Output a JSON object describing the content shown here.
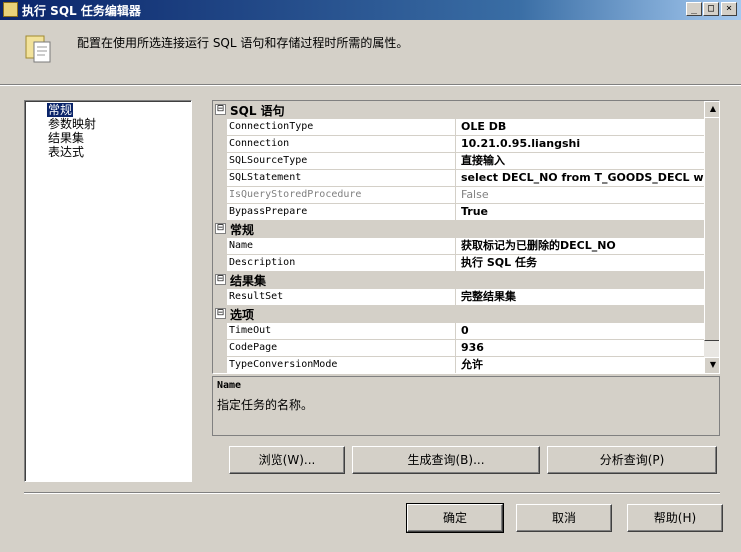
{
  "window": {
    "title": "执行 SQL 任务编辑器",
    "controls": {
      "minimize": "_",
      "maximize": "□",
      "close": "×"
    }
  },
  "header": {
    "description": "配置在使用所选连接运行 SQL 语句和存储过程时所需的属性。",
    "icon": "task-document-icon"
  },
  "nav": {
    "items": [
      {
        "label": "常规",
        "selected": true
      },
      {
        "label": "参数映射",
        "selected": false
      },
      {
        "label": "结果集",
        "selected": false
      },
      {
        "label": "表达式",
        "selected": false
      }
    ]
  },
  "grid": {
    "categories": [
      {
        "label": "SQL 语句",
        "expander": "⊟",
        "rows": [
          {
            "name": "ConnectionType",
            "value": "OLE DB"
          },
          {
            "name": "Connection",
            "value": "10.21.0.95.liangshi"
          },
          {
            "name": "SQLSourceType",
            "value": "直接输入"
          },
          {
            "name": "SQLStatement",
            "value": "select DECL_NO from T_GOODS_DECL wh"
          },
          {
            "name": "IsQueryStoredProcedure",
            "value": "False",
            "disabled": true
          },
          {
            "name": "BypassPrepare",
            "value": "True"
          }
        ]
      },
      {
        "label": "常规",
        "expander": "⊟",
        "rows": [
          {
            "name": "Name",
            "value": "获取标记为已删除的DECL_NO"
          },
          {
            "name": "Description",
            "value": "执行 SQL 任务"
          }
        ]
      },
      {
        "label": "结果集",
        "expander": "⊟",
        "rows": [
          {
            "name": "ResultSet",
            "value": "完整结果集"
          }
        ]
      },
      {
        "label": "选项",
        "expander": "⊟",
        "rows": [
          {
            "name": "TimeOut",
            "value": "0"
          },
          {
            "name": "CodePage",
            "value": "936"
          },
          {
            "name": "TypeConversionMode",
            "value": "允许"
          }
        ]
      }
    ]
  },
  "description_panel": {
    "title": "Name",
    "text": "指定任务的名称。"
  },
  "actions": {
    "browse": "浏览(W)...",
    "build_query": "生成查询(B)...",
    "parse_query": "分析查询(P)"
  },
  "footer": {
    "ok": "确定",
    "cancel": "取消",
    "help": "帮助(H)"
  },
  "colors": {
    "titlebar_start": "#0a246a",
    "selection": "#0a246a",
    "face": "#d4d0c8"
  }
}
